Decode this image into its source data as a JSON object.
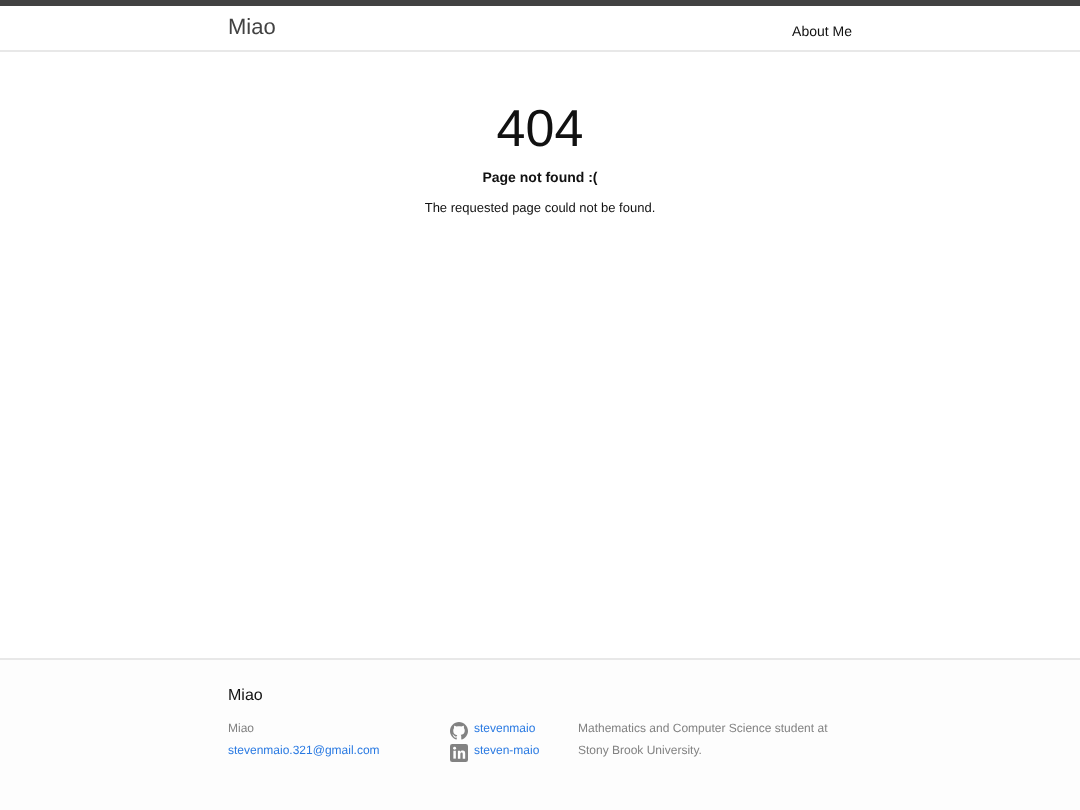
{
  "header": {
    "site_title": "Miao",
    "nav": [
      {
        "label": "About Me"
      }
    ]
  },
  "main": {
    "code": "404",
    "heading": "Page not found :(",
    "message": "The requested page could not be found."
  },
  "footer": {
    "title": "Miao",
    "name": "Miao",
    "email": "stevenmaio.321@gmail.com",
    "social": [
      {
        "kind": "github",
        "label": "stevenmaio"
      },
      {
        "kind": "linkedin",
        "label": "steven-maio"
      }
    ],
    "description": "Mathematics and Computer Science student at Stony Brook University."
  }
}
